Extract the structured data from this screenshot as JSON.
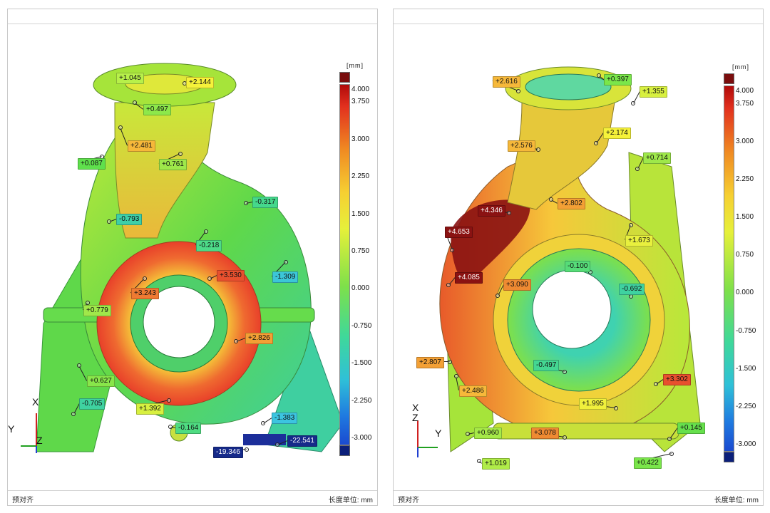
{
  "panels": [
    {
      "footer_left": "预对齐",
      "footer_right": "长度单位: mm",
      "colorbar": {
        "unit": "[mm]",
        "ticks": [
          "4.000",
          "3.750",
          "3.000",
          "2.250",
          "1.500",
          "0.750",
          "0.000",
          "-0.750",
          "-1.500",
          "-2.250",
          "-3.000"
        ],
        "top_box_color": "#7a0d0d",
        "bottom_box_color": "#0b1f7a"
      },
      "axes": {
        "x": "X",
        "y": "Y",
        "z": "Z"
      },
      "labels": [
        {
          "text": "+1.045",
          "color": "#b7f04a"
        },
        {
          "text": "+2.144",
          "color": "#f6f23a"
        },
        {
          "text": "+0.497",
          "color": "#8de84a"
        },
        {
          "text": "+2.481",
          "color": "#f6b83a"
        },
        {
          "text": "+0.087",
          "color": "#5fe04c"
        },
        {
          "text": "+0.761",
          "color": "#9ee84a"
        },
        {
          "text": "-0.317",
          "color": "#45d88c"
        },
        {
          "text": "-0.793",
          "color": "#3ecfa8"
        },
        {
          "text": "-0.218",
          "color": "#4ddb88"
        },
        {
          "text": "-1.309",
          "color": "#3cc6d8"
        },
        {
          "text": "+3.530",
          "color": "#e8502e"
        },
        {
          "text": "+3.243",
          "color": "#ef7a32"
        },
        {
          "text": "+0.779",
          "color": "#a0e84a"
        },
        {
          "text": "+2.826",
          "color": "#f3a035"
        },
        {
          "text": "+0.627",
          "color": "#88e64a"
        },
        {
          "text": "+1.392",
          "color": "#d8f040"
        },
        {
          "text": "-0.705",
          "color": "#3fd2a0"
        },
        {
          "text": "-0.164",
          "color": "#4fdc82"
        },
        {
          "text": "-1.383",
          "color": "#3cc4e0"
        },
        {
          "text": "-19.346",
          "color": "#162a8a"
        },
        {
          "text": "-22.541",
          "color": "#162a8a"
        }
      ]
    },
    {
      "footer_left": "预对齐",
      "footer_right": "长度单位: mm",
      "colorbar": {
        "unit": "[mm]",
        "ticks": [
          "4.000",
          "3.750",
          "3.000",
          "2.250",
          "1.500",
          "0.750",
          "0.000",
          "-0.750",
          "-1.500",
          "-2.250",
          "-3.000"
        ],
        "top_box_color": "#7a0d0d",
        "bottom_box_color": "#0b1f7a"
      },
      "axes": {
        "x": "X",
        "y": "Y",
        "z": "Z"
      },
      "labels": [
        {
          "text": "+2.616",
          "color": "#f6b83a"
        },
        {
          "text": "+0.397",
          "color": "#7ae64a"
        },
        {
          "text": "+1.355",
          "color": "#d8f040"
        },
        {
          "text": "+2.174",
          "color": "#f6f23a"
        },
        {
          "text": "+2.576",
          "color": "#f6b83a"
        },
        {
          "text": "+0.714",
          "color": "#9ee84a"
        },
        {
          "text": "+4.346",
          "color": "#8a1212"
        },
        {
          "text": "+2.802",
          "color": "#f3a035"
        },
        {
          "text": "+4.653",
          "color": "#8a1212"
        },
        {
          "text": "+1.673",
          "color": "#e8f03e"
        },
        {
          "text": "-0.100",
          "color": "#56dc78"
        },
        {
          "text": "+4.085",
          "color": "#8a1212"
        },
        {
          "text": "+3.090",
          "color": "#ef8a32"
        },
        {
          "text": "-0.692",
          "color": "#3fd2a0"
        },
        {
          "text": "+2.807",
          "color": "#f3a035"
        },
        {
          "text": "-0.497",
          "color": "#44d692"
        },
        {
          "text": "+3.302",
          "color": "#e8502e"
        },
        {
          "text": "+2.486",
          "color": "#f6b83a"
        },
        {
          "text": "+1.995",
          "color": "#f0f03c"
        },
        {
          "text": "+0.960",
          "color": "#a6ea48"
        },
        {
          "text": "+3.078",
          "color": "#ef8a32"
        },
        {
          "text": "+0.145",
          "color": "#66e04c"
        },
        {
          "text": "+1.019",
          "color": "#b0ec48"
        },
        {
          "text": "+0.422",
          "color": "#7ae64a"
        }
      ]
    }
  ]
}
